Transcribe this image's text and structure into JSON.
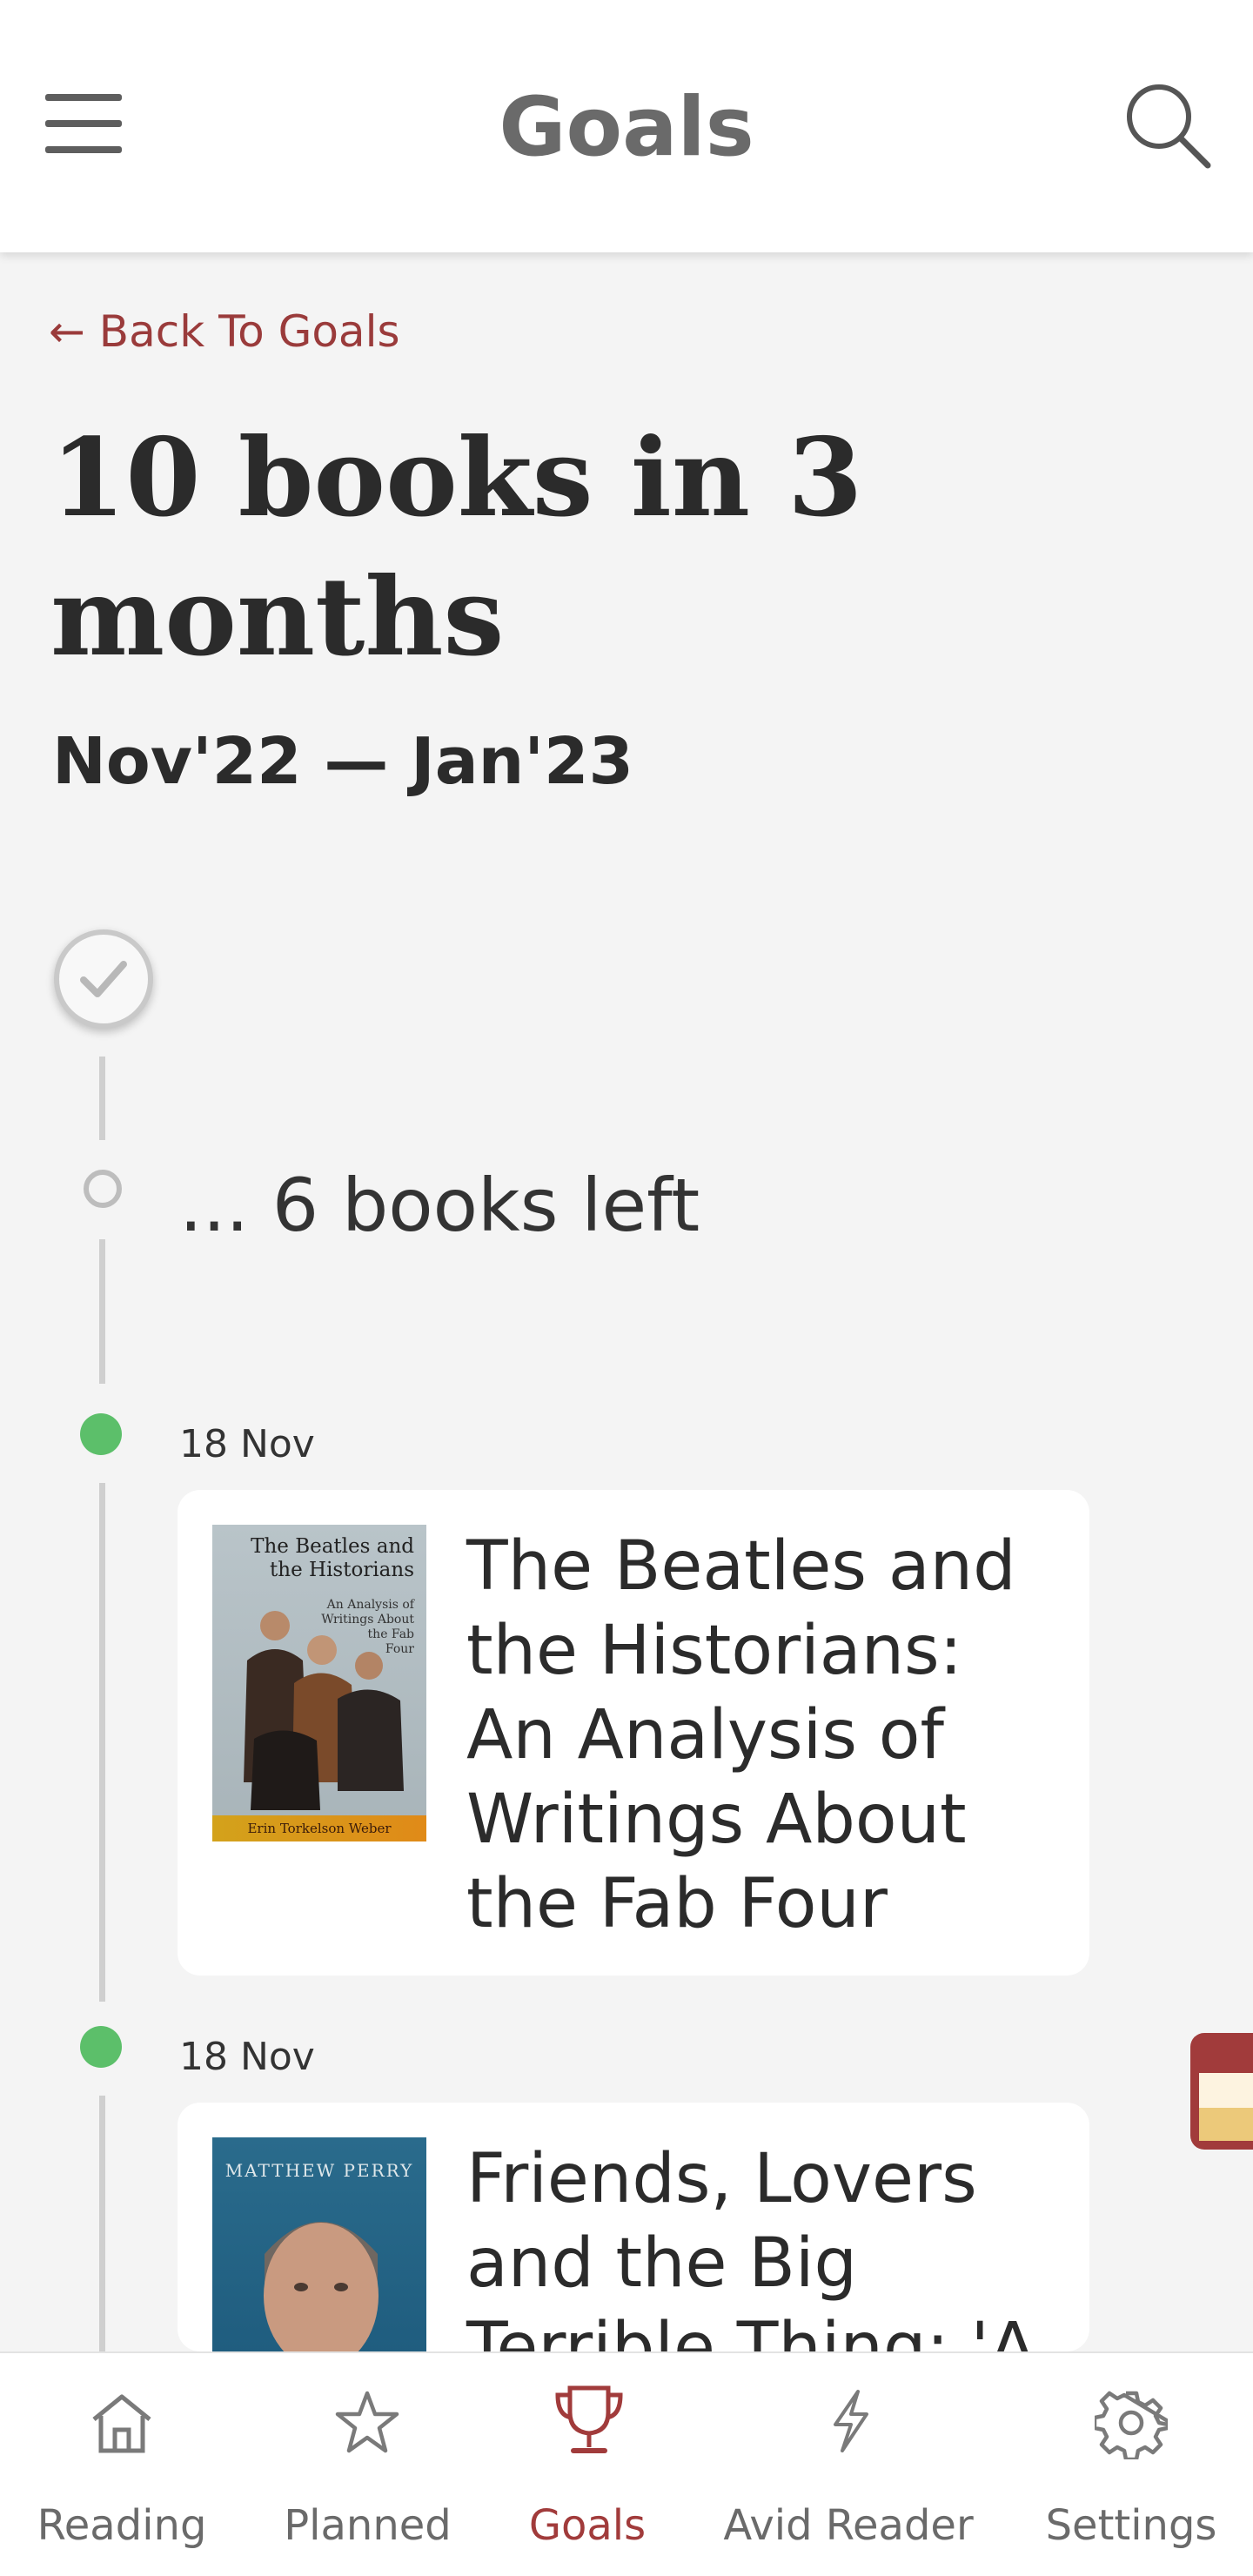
{
  "app_bar": {
    "title": "Goals",
    "menu_icon": "hamburger-menu-icon",
    "search_icon": "search-icon"
  },
  "back_link": {
    "label": "← Back To Goals"
  },
  "goal": {
    "title": "10 books in 3 months",
    "period": "Nov'22 — Jan'23",
    "books_left_text": "... 6 books left"
  },
  "timeline": {
    "entries": [
      {
        "date": "18 Nov",
        "book_title": "The Beatles and the Historians: An Analysis of Writings About the Fab Four",
        "cover": {
          "title_lines": [
            "The Beatles and",
            "the Historians"
          ],
          "subtitle_lines": [
            "An Analysis of",
            "Writings About",
            "the Fab",
            "Four"
          ],
          "author": "Erin Torkelson Weber"
        }
      },
      {
        "date": "18 Nov",
        "book_title": "Friends, Lovers and the Big Terrible Thing: 'A",
        "cover": {
          "author": "MATTHEW PERRY"
        }
      }
    ]
  },
  "bottom_nav": {
    "items": [
      {
        "label": "Reading",
        "icon": "home-icon",
        "active": false
      },
      {
        "label": "Planned",
        "icon": "star-icon",
        "active": false
      },
      {
        "label": "Goals",
        "icon": "trophy-icon",
        "active": true
      },
      {
        "label": "Avid Reader",
        "icon": "lightning-icon",
        "active": false
      },
      {
        "label": "Settings",
        "icon": "gear-icon",
        "active": false
      }
    ]
  },
  "colors": {
    "accent": "#a13b3b",
    "background": "#f4f4f4",
    "done_dot": "#5cbf6a",
    "nav_inactive": "#6a6a6a"
  }
}
